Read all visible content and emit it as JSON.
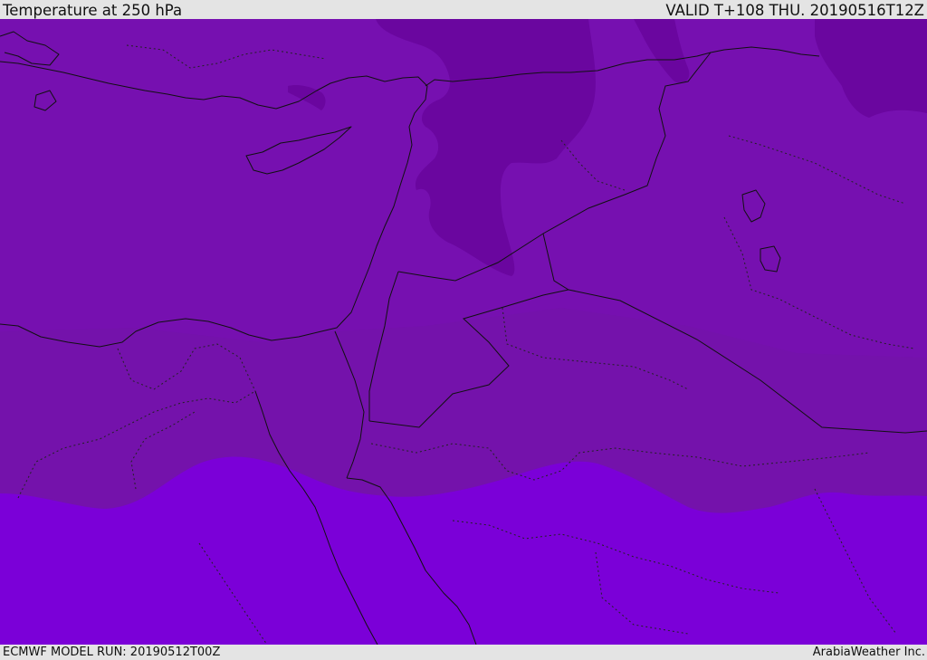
{
  "header": {
    "title": "Temperature at 250 hPa",
    "valid_time": "VALID T+108 THU. 20190516T12Z"
  },
  "footer": {
    "model_run": "ECMWF MODEL RUN: 20190512T00Z",
    "credit": "ArabiaWeather Inc."
  },
  "colors": {
    "band_cold": "#6a069f",
    "band_cool": "#7610b0",
    "band_mid": "#7412ab",
    "band_warm": "#7b00d8",
    "borders": "#111111"
  }
}
